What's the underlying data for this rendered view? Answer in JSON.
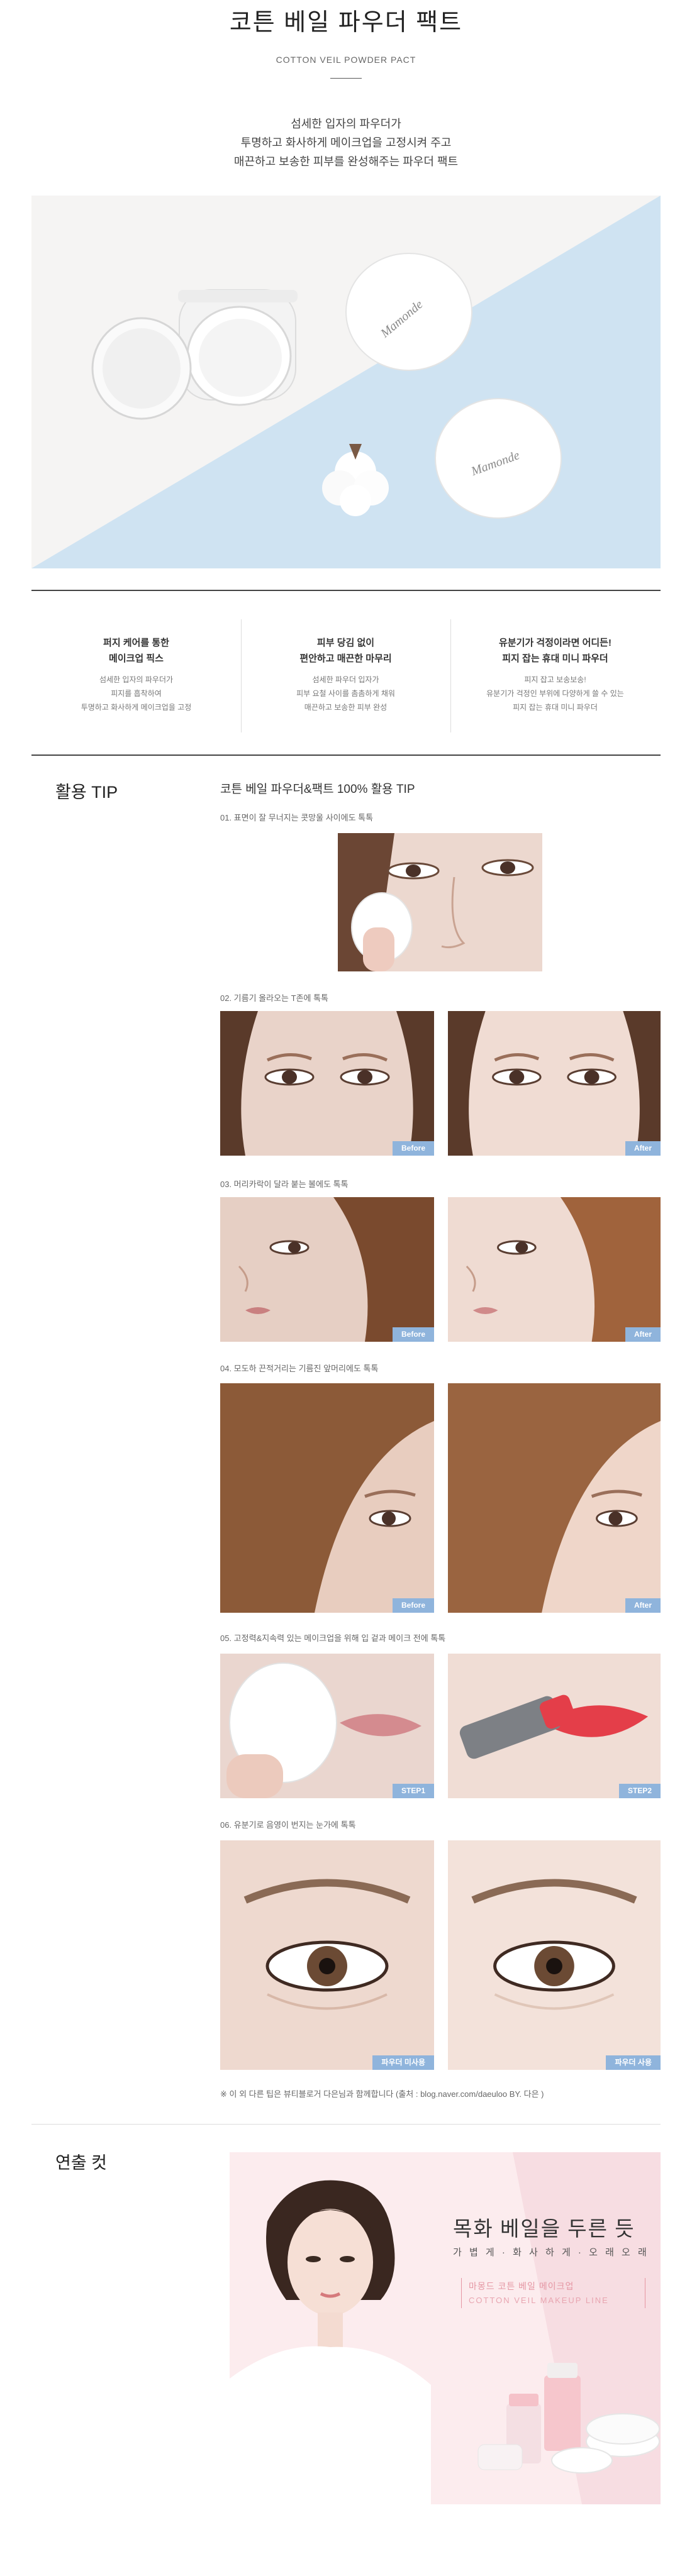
{
  "header": {
    "title": "코튼 베일 파우더 팩트",
    "subtitle": "COTTON VEIL POWDER PACT",
    "intro": [
      "섬세한 입자의 파우더가",
      "투명하고 화사하게 메이크업을 고정시켜 주고",
      "매끈하고 보송한 피부를 완성해주는 파우더 팩트"
    ]
  },
  "hero": {
    "brand": "Mamonde"
  },
  "features": [
    {
      "title_lines": [
        "퍼지 케어를 통한",
        "메이크업 픽스"
      ],
      "desc_lines": [
        "섬세한 입자의 파우더가",
        "피지를 흡착하여",
        "투명하고 화사하게 메이크업을 고정"
      ]
    },
    {
      "title_lines": [
        "피부 당김 없이",
        "편안하고 매끈한 마무리"
      ],
      "desc_lines": [
        "섬세한 파우더 입자가",
        "피부 요철 사이를 촘촘하게 채워",
        "매끈하고 보송한 피부 완성"
      ]
    },
    {
      "title_lines": [
        "유분기가 걱정이라면 어디든!",
        "피지 잡는 휴대 미니 파우더"
      ],
      "desc_lines": [
        "피지 잡고 보송보송!",
        "유분기가 걱정인 부위에 다양하게 쓸 수 있는",
        "피지 잡는 휴대 미니 파우더"
      ]
    }
  ],
  "tip": {
    "heading": "활용 TIP",
    "title": "코튼 베일 파우더&팩트 100% 활용 TIP",
    "steps": [
      {
        "label": "01. 표면이 잘 무너지는 콧망울 사이에도 톡톡"
      },
      {
        "label": "02. 기름기 올라오는 T존에 톡톡",
        "left_badge": "Before",
        "right_badge": "After"
      },
      {
        "label": "03. 머리카락이 달라 붙는 볼에도 톡톡",
        "left_badge": "Before",
        "right_badge": "After"
      },
      {
        "label": "04. 모도하 끈적거리는 기름진 앞머리에도 톡톡",
        "left_badge": "Before",
        "right_badge": "After"
      },
      {
        "label": "05. 고정력&지속력 있는 메이크업을 위해 입 겉과 메이크 전에 톡톡",
        "left_badge": "STEP1",
        "right_badge": "STEP2"
      },
      {
        "label": "06. 유분기로 음영이 번지는 눈가에 톡톡",
        "left_badge": "파우더 미사용",
        "right_badge": "파우더 사용"
      }
    ],
    "note": "※ 이 외 다른 팁은 뷰티블로거 다은님과 함께합니다 (출처 : blog.naver.com/daeuloo BY. 다은 )"
  },
  "ad_section": {
    "heading": "연출 컷",
    "headline": "목화 베일을 두른 듯",
    "sub": "가 볍 게 · 화 사 하 게 · 오 래 오 래",
    "line1": "마몽드 코튼 베일 메이크업",
    "line2": "COTTON VEIL MAKEUP LINE"
  },
  "colors": {
    "badge": "#8fb4dc",
    "hero_blue": "#cfe3f2",
    "ad_pink": "#fbe9ea",
    "accent_pink": "#e596a3"
  }
}
